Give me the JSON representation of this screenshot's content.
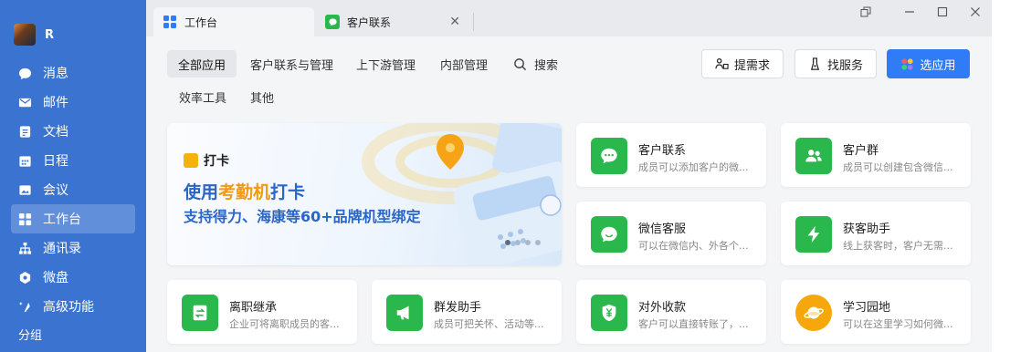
{
  "sidebar": {
    "profile_name": "R",
    "items": [
      {
        "label": "消息",
        "icon": "chat-bubble-icon"
      },
      {
        "label": "邮件",
        "icon": "mail-icon"
      },
      {
        "label": "文档",
        "icon": "document-icon"
      },
      {
        "label": "日程",
        "icon": "calendar-icon"
      },
      {
        "label": "会议",
        "icon": "meeting-icon"
      },
      {
        "label": "工作台",
        "icon": "workbench-icon"
      },
      {
        "label": "通讯录",
        "icon": "contacts-icon"
      },
      {
        "label": "微盘",
        "icon": "cloud-drive-icon"
      },
      {
        "label": "高级功能",
        "icon": "sparkle-icon"
      }
    ],
    "group_label": "分组"
  },
  "tabs": [
    {
      "label": "工作台"
    },
    {
      "label": "客户联系"
    }
  ],
  "categories": [
    "全部应用",
    "客户联系与管理",
    "上下游管理",
    "内部管理",
    "搜索",
    "效率工具",
    "其他"
  ],
  "actions": {
    "request": "提需求",
    "service": "找服务",
    "choose": "选应用"
  },
  "banner": {
    "tag": "打卡",
    "headline_prefix": "使用",
    "headline_highlight": "考勤机",
    "headline_suffix": "打卡",
    "subline": "支持得力、海康等60+品牌机型绑定",
    "slides": 4
  },
  "apps": [
    {
      "title": "客户联系",
      "desc": "成员可以添加客户的微...",
      "color": "#2ab84d",
      "icon": "chat-icon"
    },
    {
      "title": "客户群",
      "desc": "成员可以创建包含微信...",
      "color": "#2ab84d",
      "icon": "group-icon"
    },
    {
      "title": "微信客服",
      "desc": "可以在微信内、外各个...",
      "color": "#2ab84d",
      "icon": "service-chat-icon"
    },
    {
      "title": "获客助手",
      "desc": "线上获客时，客户无需...",
      "color": "#2ab84d",
      "icon": "lightning-icon"
    },
    {
      "title": "离职继承",
      "desc": "企业可将离职成员的客...",
      "color": "#2ab84d",
      "icon": "transfer-icon"
    },
    {
      "title": "群发助手",
      "desc": "成员可把关怀、活动等...",
      "color": "#2ab84d",
      "icon": "megaphone-icon"
    },
    {
      "title": "对外收款",
      "desc": "客户可以直接转账了，...",
      "color": "#2ab84d",
      "icon": "yuan-shield-icon"
    },
    {
      "title": "学习园地",
      "desc": "可以在这里学习如何微...",
      "color": "#f5a70c",
      "icon": "planet-icon"
    }
  ],
  "colors": {
    "sidebar": "#3a74d0",
    "primary": "#2f7cf6",
    "app_green": "#2ab84d"
  }
}
